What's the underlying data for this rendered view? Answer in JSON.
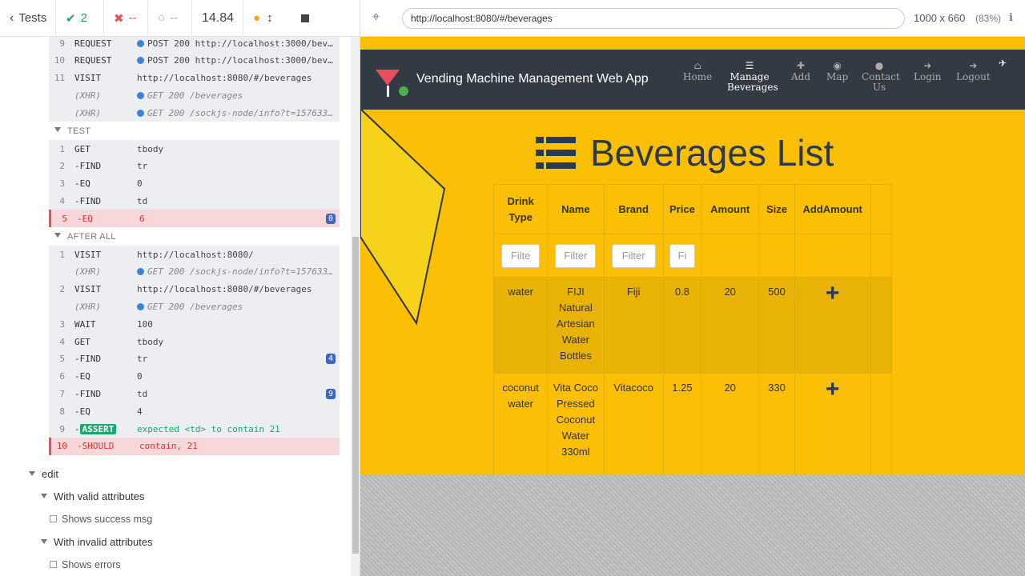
{
  "topbar": {
    "tests_label": "Tests",
    "passed": "2",
    "failed": "--",
    "pending": "--",
    "duration": "14.84"
  },
  "url": "http://localhost:8080/#/beverages",
  "viewport_size": "1000 x 660",
  "viewport_zoom": "(83%)",
  "commands": {
    "pre": [
      {
        "n": "9",
        "c": "REQUEST",
        "m": "POST 200 http://localhost:3000/bev…",
        "dot": true
      },
      {
        "n": "10",
        "c": "REQUEST",
        "m": "POST 200 http://localhost:3000/bev…",
        "dot": true
      },
      {
        "n": "11",
        "c": "VISIT",
        "m": "http://localhost:8080/#/beverages"
      },
      {
        "n": "",
        "c": "(XHR)",
        "m": "GET 200 /beverages",
        "dot": true,
        "x": true
      },
      {
        "n": "",
        "c": "(XHR)",
        "m": "GET 200 /sockjs-node/info?t=157633…",
        "dot": true,
        "x": true
      }
    ],
    "test_label": "TEST",
    "test": [
      {
        "n": "1",
        "c": "GET",
        "m": "tbody"
      },
      {
        "n": "2",
        "c": "-FIND",
        "m": "tr"
      },
      {
        "n": "3",
        "c": "-EQ",
        "m": "0"
      },
      {
        "n": "4",
        "c": "-FIND",
        "m": "td"
      },
      {
        "n": "5",
        "c": "-EQ",
        "m": "6",
        "fail": true,
        "badge": "0"
      }
    ],
    "after_label": "AFTER ALL",
    "after": [
      {
        "n": "1",
        "c": "VISIT",
        "m": "http://localhost:8080/"
      },
      {
        "n": "",
        "c": "(XHR)",
        "m": "GET 200 /sockjs-node/info?t=157633…",
        "dot": true,
        "x": true
      },
      {
        "n": "2",
        "c": "VISIT",
        "m": "http://localhost:8080/#/beverages"
      },
      {
        "n": "",
        "c": "(XHR)",
        "m": "GET 200 /beverages",
        "dot": true,
        "x": true
      },
      {
        "n": "3",
        "c": "WAIT",
        "m": "100"
      },
      {
        "n": "4",
        "c": "GET",
        "m": "tbody"
      },
      {
        "n": "5",
        "c": "-FIND",
        "m": "tr",
        "badge": "4"
      },
      {
        "n": "6",
        "c": "-EQ",
        "m": "0"
      },
      {
        "n": "7",
        "c": "-FIND",
        "m": "td",
        "badge": "9"
      },
      {
        "n": "8",
        "c": "-EQ",
        "m": "4"
      },
      {
        "n": "9",
        "c": "-ASSERT",
        "m": "expected <td> to contain 21",
        "assert": true
      },
      {
        "n": "10",
        "c": "-SHOULD",
        "m": "contain, 21",
        "fail": true
      }
    ]
  },
  "tree": {
    "edit": "edit",
    "valid": "With valid attributes",
    "valid_test": "Shows success msg",
    "invalid": "With invalid attributes",
    "invalid_test": "Shows errors"
  },
  "app": {
    "brand": "Vending Machine Management Web App",
    "nav": [
      "Home",
      "Manage Beverages",
      "Add",
      "Map",
      "Contact Us",
      "Login",
      "Logout"
    ],
    "title": "Beverages List",
    "headers": [
      "Drink Type",
      "Name",
      "Brand",
      "Price",
      "Amount",
      "Size",
      "AddAmount"
    ],
    "filters": [
      "Filte",
      "Filter",
      "Filter",
      "Fi"
    ],
    "rows": [
      [
        "water",
        "FIJI Natural Artesian Water Bottles",
        "Fiji",
        "0.8",
        "20",
        "500"
      ],
      [
        "coconut water",
        "Vita Coco Pressed Coconut Water 330ml",
        "Vitacoco",
        "1.25",
        "20",
        "330"
      ]
    ]
  }
}
